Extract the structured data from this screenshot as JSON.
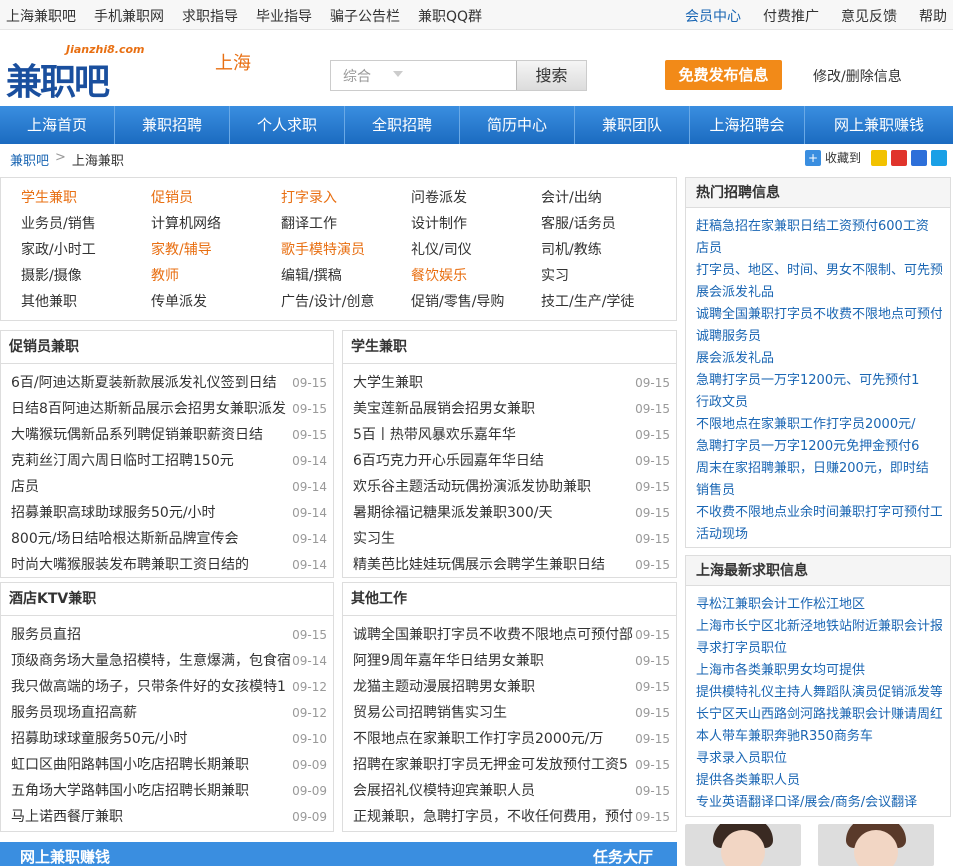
{
  "topbar": {
    "left": [
      "上海兼职吧",
      "手机兼职网",
      "求职指导",
      "毕业指导",
      "骗子公告栏",
      "兼职QQ群"
    ],
    "right": [
      "会员中心",
      "付费推广",
      "意见反馈",
      "帮助"
    ]
  },
  "header": {
    "logo_text": "兼职吧",
    "logo_domain": "Jianzhi8.com",
    "city": "上海",
    "search_type": "综合",
    "search_button": "搜索",
    "publish_button": "免费发布信息",
    "modify_link": "修改/删除信息"
  },
  "nav": [
    "上海首页",
    "兼职招聘",
    "个人求职",
    "全职招聘",
    "简历中心",
    "兼职团队",
    "上海招聘会",
    "网上兼职赚钱"
  ],
  "breadcrumb": {
    "home": "兼职吧",
    "sep": ">",
    "current": "上海兼职",
    "fav": "收藏到"
  },
  "categories": [
    [
      {
        "t": "学生兼职",
        "hot": true
      },
      {
        "t": "促销员",
        "hot": true
      },
      {
        "t": "打字录入",
        "hot": true
      },
      {
        "t": "问卷派发",
        "hot": false
      },
      {
        "t": "会计/出纳",
        "hot": false
      }
    ],
    [
      {
        "t": "业务员/销售",
        "hot": false
      },
      {
        "t": "计算机网络",
        "hot": false
      },
      {
        "t": "翻译工作",
        "hot": false
      },
      {
        "t": "设计制作",
        "hot": false
      },
      {
        "t": "客服/话务员",
        "hot": false
      }
    ],
    [
      {
        "t": "家政/小时工",
        "hot": false
      },
      {
        "t": "家教/辅导",
        "hot": true
      },
      {
        "t": "歌手模特演员",
        "hot": true
      },
      {
        "t": "礼仪/司仪",
        "hot": false
      },
      {
        "t": "司机/教练",
        "hot": false
      }
    ],
    [
      {
        "t": "摄影/摄像",
        "hot": false
      },
      {
        "t": "教师",
        "hot": true
      },
      {
        "t": "编辑/撰稿",
        "hot": false
      },
      {
        "t": "餐饮娱乐",
        "hot": true
      },
      {
        "t": "实习",
        "hot": false
      }
    ],
    [
      {
        "t": "其他兼职",
        "hot": false
      },
      {
        "t": "传单派发",
        "hot": false
      },
      {
        "t": "广告/设计/创意",
        "hot": false
      },
      {
        "t": "促销/零售/导购",
        "hot": false
      },
      {
        "t": "技工/生产/学徒",
        "hot": false
      }
    ]
  ],
  "boxes": [
    {
      "title": "促销员兼职",
      "items": [
        {
          "t": "6百/阿迪达斯夏装新款展派发礼仪签到日结",
          "d": "09-15"
        },
        {
          "t": "日结8百阿迪达斯新品展示会招男女兼职派发",
          "d": "09-15"
        },
        {
          "t": "大嘴猴玩偶新品系列聘促销兼职薪资日结",
          "d": "09-15"
        },
        {
          "t": "克莉丝汀周六周日临时工招聘150元",
          "d": "09-14"
        },
        {
          "t": "店员",
          "d": "09-14"
        },
        {
          "t": "招募兼职高球助球服务50元/小时",
          "d": "09-14"
        },
        {
          "t": "800元/场日结哈根达斯新品牌宣传会",
          "d": "09-14"
        },
        {
          "t": "时尚大嘴猴服装发布聘兼职工资日结的",
          "d": "09-14"
        }
      ]
    },
    {
      "title": "学生兼职",
      "items": [
        {
          "t": "大学生兼职",
          "d": "09-15"
        },
        {
          "t": "美宝莲新品展销会招男女兼职",
          "d": "09-15"
        },
        {
          "t": "5百丨热带风暴欢乐嘉年华",
          "d": "09-15"
        },
        {
          "t": "6百巧克力开心乐园嘉年华日结",
          "d": "09-15"
        },
        {
          "t": "欢乐谷主题活动玩偶扮演派发协助兼职",
          "d": "09-15"
        },
        {
          "t": "暑期徐福记糖果派发兼职300/天",
          "d": "09-15"
        },
        {
          "t": "实习生",
          "d": "09-15"
        },
        {
          "t": "精美芭比娃娃玩偶展示会聘学生兼职日结",
          "d": "09-15"
        }
      ]
    },
    {
      "title": "酒店KTV兼职",
      "items": [
        {
          "t": "服务员直招",
          "d": "09-15"
        },
        {
          "t": "顶级商务场大量急招模特，生意爆满，包食宿",
          "d": "09-14"
        },
        {
          "t": "我只做高端的场子，只带条件好的女孩模特1",
          "d": "09-12"
        },
        {
          "t": "服务员现场直招高薪",
          "d": "09-12"
        },
        {
          "t": "招募助球球童服务50元/小时",
          "d": "09-10"
        },
        {
          "t": "虹口区曲阳路韩国小吃店招聘长期兼职",
          "d": "09-09"
        },
        {
          "t": "五角场大学路韩国小吃店招聘长期兼职",
          "d": "09-09"
        },
        {
          "t": "马上诺西餐厅兼职",
          "d": "09-09"
        }
      ]
    },
    {
      "title": "其他工作",
      "items": [
        {
          "t": "诚聘全国兼职打字员不收费不限地点可预付部",
          "d": "09-15"
        },
        {
          "t": "阿狸9周年嘉年华日结男女兼职",
          "d": "09-15"
        },
        {
          "t": "龙猫主题动漫展招聘男女兼职",
          "d": "09-15"
        },
        {
          "t": "贸易公司招聘销售实习生",
          "d": "09-15"
        },
        {
          "t": "不限地点在家兼职工作打字员2000元/万",
          "d": "09-15"
        },
        {
          "t": "招聘在家兼职打字员无押金可发放预付工资5",
          "d": "09-15"
        },
        {
          "t": "会展招礼仪模特迎宾兼职人员",
          "d": "09-15"
        },
        {
          "t": "正规兼职，急聘打字员，不收任何费用，预付",
          "d": "09-15"
        }
      ]
    }
  ],
  "side_hot": {
    "title": "热门招聘信息",
    "lines": [
      "赶稿急招在家兼职日结工资预付600工资",
      "店员",
      "打字员、地区、时间、男女不限制、可先预",
      "展会派发礼品",
      "诚聘全国兼职打字员不收费不限地点可预付",
      "诚聘服务员",
      "展会派发礼品",
      "急聘打字员一万字1200元、可先预付1",
      "行政文员",
      "不限地点在家兼职工作打字员2000元/",
      "急聘打字员一万字1200元免押金预付6",
      "周末在家招聘兼职，日赚200元，即时结",
      "销售员",
      "不收费不限地点业余时间兼职打字可预付工",
      "活动现场"
    ]
  },
  "side_new": {
    "title": "上海最新求职信息",
    "lines": [
      "寻松江兼职会计工作松江地区",
      "上海市长宁区北新泾地铁站附近兼职会计报",
      "寻求打字员职位",
      "上海市各类兼职男女均可提供",
      "提供模特礼仪主持人舞蹈队演员促销派发等",
      "长宁区天山西路剑河路找兼职会计赚请周红",
      "本人带车兼职奔驰R350商务车",
      "寻求录入员职位",
      "提供各类兼职人员",
      "专业英语翻译口译/展会/商务/会议翻译"
    ]
  },
  "bottom": {
    "left": "网上兼职赚钱",
    "right": "任务大厅"
  },
  "colors": {
    "accent": "#e86f12",
    "nav": "#1b6bc0",
    "link": "#1a66b3"
  }
}
